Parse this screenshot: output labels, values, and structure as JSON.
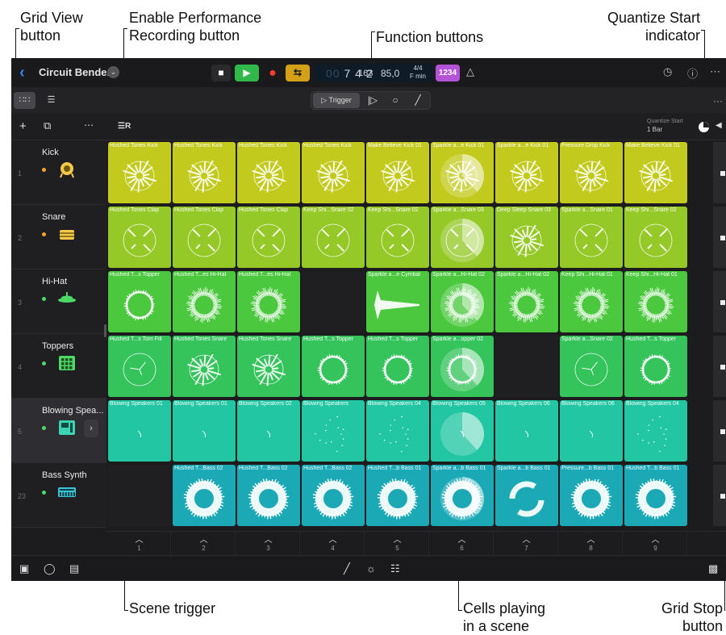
{
  "callouts": {
    "grid_view": "Grid View\nbutton",
    "enable_perf": "Enable Performance\nRecording button",
    "function_buttons": "Function buttons",
    "quantize_start": "Quantize Start\nindicator",
    "scene_trigger": "Scene trigger",
    "cells_playing": "Cells playing\nin a scene",
    "grid_stop": "Grid Stop\nbutton"
  },
  "titlebar": {
    "back_icon": "chevron-left-icon",
    "project_title": "Circuit Bender",
    "position_ghost": "00",
    "position_bar": "7 4 2",
    "position_sub": "163",
    "tempo": "85,0",
    "time_sig": "4/4",
    "key": "F min",
    "count_in": "1234"
  },
  "toolbar": {
    "trigger_label": "Trigger",
    "more": "···"
  },
  "header": {
    "quantize_label": "Quantize Start",
    "quantize_value": "1 Bar"
  },
  "tracks": [
    {
      "num": "1",
      "name": "Kick",
      "dot": "#f5a623",
      "icon": "kick-drum-icon",
      "icon_color": "#f7c948"
    },
    {
      "num": "2",
      "name": "Snare",
      "dot": "#f5a623",
      "icon": "snare-drum-icon",
      "icon_color": "#f7c948"
    },
    {
      "num": "3",
      "name": "Hi-Hat",
      "dot": "#4cd964",
      "icon": "hihat-icon",
      "icon_color": "#4cd964"
    },
    {
      "num": "4",
      "name": "Toppers",
      "dot": "#4cd964",
      "icon": "drum-machine-icon",
      "icon_color": "#4cd964"
    },
    {
      "num": "5",
      "name": "Blowing Spea...",
      "dot": "#4cd964",
      "icon": "sampler-icon",
      "icon_color": "#3bd3b0"
    },
    {
      "num": "23",
      "name": "Bass Synth",
      "dot": "#4cd964",
      "icon": "synth-keyboard-icon",
      "icon_color": "#3bc4d4"
    }
  ],
  "rows": [
    {
      "color": "#c2cb1d",
      "cells": [
        {
          "name": "Hushed Tones Kick",
          "wave": "spike"
        },
        {
          "name": "Hushed Tones Kick",
          "wave": "spike"
        },
        {
          "name": "Hushed Tones Kick",
          "wave": "spike"
        },
        {
          "name": "Hushed Tones Kick",
          "wave": "spike"
        },
        {
          "name": "Make Believe Kick 01",
          "wave": "spike"
        },
        {
          "name": "Sparkle a...e Kick 01",
          "wave": "spike",
          "playing": true,
          "progress": 0.38
        },
        {
          "name": "Sparkle a...e Kick 01",
          "wave": "spike"
        },
        {
          "name": "Pressure Drop Kick",
          "wave": "spike"
        },
        {
          "name": "Make Believe Kick 01",
          "wave": "spike"
        }
      ]
    },
    {
      "color": "#95c928",
      "cells": [
        {
          "name": "Hushed Tones Clap",
          "wave": "sparse"
        },
        {
          "name": "Hushed Tones Clap",
          "wave": "sparse"
        },
        {
          "name": "Hushed Tones Clap",
          "wave": "sparse"
        },
        {
          "name": "Keep Shi...Snare 02",
          "wave": "sparse"
        },
        {
          "name": "Keep Shi...Snare 02",
          "wave": "sparse"
        },
        {
          "name": "Sparkle a...Snare 03",
          "wave": "sparse",
          "playing": true,
          "progress": 0.38
        },
        {
          "name": "Deep Sleep Snare 03",
          "wave": "spike"
        },
        {
          "name": "Sparkle a...Snare 01",
          "wave": "sparse"
        },
        {
          "name": "Keep Shi...Snare 02",
          "wave": "sparse"
        }
      ]
    },
    {
      "color": "#4cc83f",
      "cells": [
        {
          "name": "Hushed T...s Topper",
          "wave": "ring"
        },
        {
          "name": "Hushed T...es Hi-Hat",
          "wave": "dense"
        },
        {
          "name": "Hushed T...es Hi-Hat",
          "wave": "dense"
        },
        null,
        {
          "name": "Sparkle a...e Cymbal",
          "wave": "cymbal"
        },
        {
          "name": "Sparkle a...Hi-Hat 02",
          "wave": "dense",
          "playing": true,
          "progress": 0.38
        },
        {
          "name": "Sparkle a...Hi-Hat 02",
          "wave": "dense"
        },
        {
          "name": "Keep Shi...Hi-Hat 01",
          "wave": "dense"
        },
        {
          "name": "Keep Shi...Hi-Hat 01",
          "wave": "dense"
        }
      ]
    },
    {
      "color": "#35c35c",
      "cells": [
        {
          "name": "Hushed T...s Tom Fill",
          "wave": "thin"
        },
        {
          "name": "Hushed Tones Snare",
          "wave": "spike"
        },
        {
          "name": "Hushed Tones Snare",
          "wave": "spike"
        },
        {
          "name": "Hushed T...s Topper",
          "wave": "ring"
        },
        {
          "name": "Hushed T...s Topper",
          "wave": "ring"
        },
        {
          "name": "Sparkle a...opper 02",
          "wave": "ring",
          "playing": true,
          "progress": 0.38
        },
        null,
        {
          "name": "Sparkle a...Snare 02",
          "wave": "thin"
        },
        {
          "name": "Hushed T...s Topper",
          "wave": "ring"
        }
      ]
    },
    {
      "color": "#22c6a3",
      "cells": [
        {
          "name": "Blowing Speakers 01",
          "wave": "tick"
        },
        {
          "name": "Blowing Speakers 01",
          "wave": "tick"
        },
        {
          "name": "Blowing Speakers 02",
          "wave": "tick"
        },
        {
          "name": "Blowing Speakers",
          "wave": "dots"
        },
        {
          "name": "Blowing Speakers 04",
          "wave": "dots"
        },
        {
          "name": "Blowing Speakers 05",
          "wave": "tick",
          "playing": true,
          "progress": 0.38
        },
        {
          "name": "Blowing Speakers 06",
          "wave": "tick"
        },
        {
          "name": "Blowing Speakers 06",
          "wave": "tick"
        },
        {
          "name": "Blowing Speakers 04",
          "wave": "dots"
        }
      ]
    },
    {
      "color": "#1ba9b6",
      "cells": [
        null,
        {
          "name": "Hushed T...Bass 02",
          "wave": "fat"
        },
        {
          "name": "Hushed T...Bass 02",
          "wave": "fat"
        },
        {
          "name": "Hushed T...Bass 02",
          "wave": "fat"
        },
        {
          "name": "Hushed T...b Bass 01",
          "wave": "fat"
        },
        {
          "name": "Sparkle a...b Bass 01",
          "wave": "fat",
          "playing": true,
          "progress": 0.38
        },
        {
          "name": "Sparkle a...b Bass 01",
          "wave": "arrows"
        },
        {
          "name": "Pressure...b Bass 01",
          "wave": "fat"
        },
        {
          "name": "Hushed T...b Bass 01",
          "wave": "fat"
        }
      ]
    }
  ],
  "scenes": [
    "1",
    "2",
    "3",
    "4",
    "5",
    "6",
    "7",
    "8",
    "9"
  ],
  "bottombar": {
    "left_icons": [
      "media-browser-icon",
      "view-toggle-icon",
      "info-icon"
    ],
    "center_icons": [
      "pencil-icon",
      "brightness-icon",
      "mixer-icon"
    ],
    "right_icon": "keyboard-icon"
  }
}
